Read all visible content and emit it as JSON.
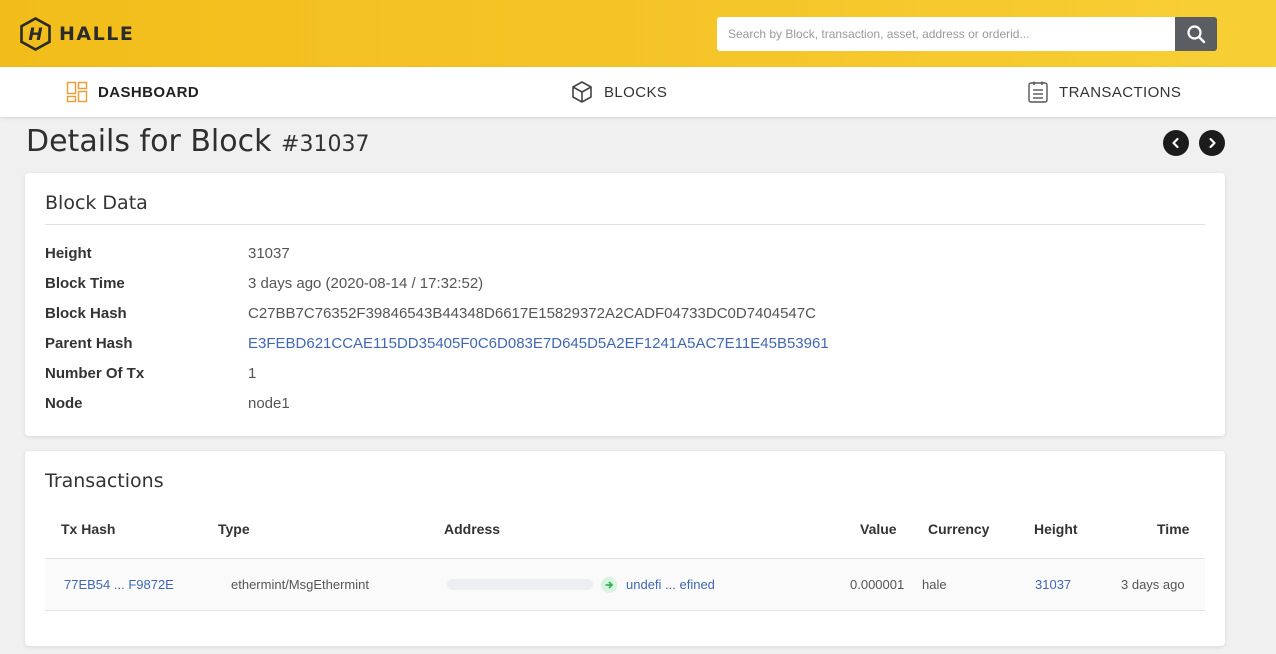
{
  "brand": {
    "name": "HALLE"
  },
  "search": {
    "placeholder": "Search by Block, transaction, asset, address or orderid...",
    "value": ""
  },
  "nav": {
    "items": [
      {
        "label": "DASHBOARD",
        "icon": "dashboard-icon",
        "active": true
      },
      {
        "label": "BLOCKS",
        "icon": "cube-icon",
        "active": false
      },
      {
        "label": "TRANSACTIONS",
        "icon": "clipboard-list-icon",
        "active": false
      }
    ]
  },
  "page": {
    "title": "Details for Block",
    "block_number": "#31037"
  },
  "block_data": {
    "title": "Block Data",
    "rows": [
      {
        "label": "Height",
        "value": "31037"
      },
      {
        "label": "Block Time",
        "value": "3 days ago (2020-08-14 / 17:32:52)"
      },
      {
        "label": "Block Hash",
        "value": "C27BB7C76352F39846543B44348D6617E15829372A2CADF04733DC0D7404547C"
      },
      {
        "label": "Parent Hash",
        "value": "E3FEBD621CCAE115DD35405F0C6D083E7D645D5A2EF1241A5AC7E11E45B53961"
      },
      {
        "label": "Number Of Tx",
        "value": "1"
      },
      {
        "label": "Node",
        "value": "node1"
      }
    ]
  },
  "transactions": {
    "title": "Transactions",
    "columns": [
      "Tx Hash",
      "Type",
      "Address",
      "Value",
      "Currency",
      "Height",
      "Time"
    ],
    "rows": [
      {
        "tx_hash": "77EB54 ... F9872E",
        "type": "ethermint/MsgEthermint",
        "address": "undefi ... efined",
        "value": "0.000001",
        "currency": "hale",
        "height": "31037",
        "time": "3 days ago"
      }
    ]
  },
  "colors": {
    "header": "#f5c62a",
    "link": "#4267b2",
    "dark": "#1c1c1c",
    "search_button": "#5a5e63"
  }
}
